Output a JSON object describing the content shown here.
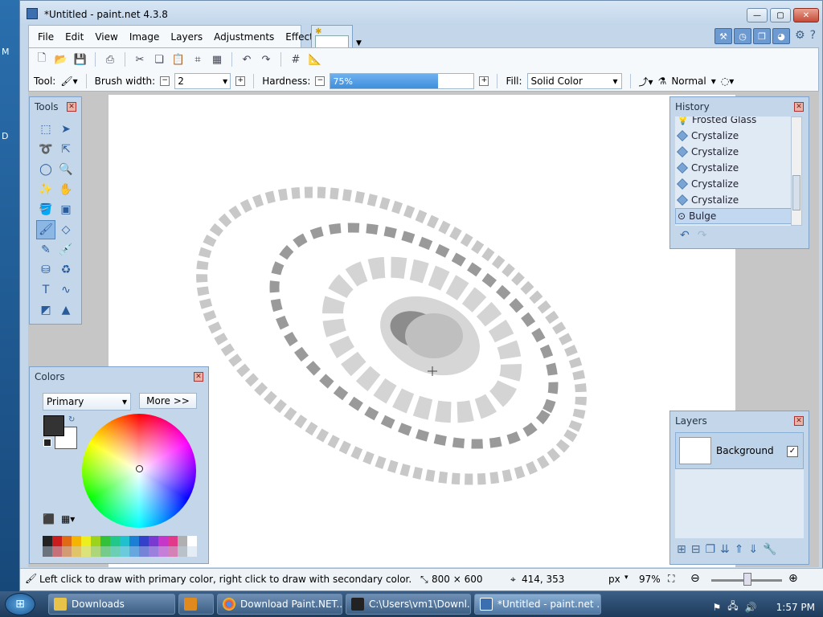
{
  "desktop": {
    "labels": [
      "M",
      "D"
    ]
  },
  "window": {
    "title": "*Untitled - paint.net 4.3.8"
  },
  "menu": [
    "File",
    "Edit",
    "View",
    "Image",
    "Layers",
    "Adjustments",
    "Effects"
  ],
  "toolbar": {
    "tool_label": "Tool:",
    "brush_width_label": "Brush width:",
    "brush_width_value": "2",
    "hardness_label": "Hardness:",
    "hardness_value": "75%",
    "hardness_fraction": 0.75,
    "fill_label": "Fill:",
    "fill_value": "Solid Color",
    "blend_mode": "Normal"
  },
  "tools_panel": {
    "title": "Tools"
  },
  "colors_panel": {
    "title": "Colors",
    "mode": "Primary",
    "more_label": "More >>",
    "primary_color": "#333333",
    "secondary_color": "#ffffff"
  },
  "history_panel": {
    "title": "History",
    "items": [
      "Frosted Glass",
      "Crystalize",
      "Crystalize",
      "Crystalize",
      "Crystalize",
      "Crystalize",
      "Bulge"
    ]
  },
  "layers_panel": {
    "title": "Layers",
    "layer_name": "Background"
  },
  "status": {
    "hint": "Left click to draw with primary color, right click to draw with secondary color.",
    "image_size": "800 × 600",
    "cursor_pos": "414, 353",
    "unit": "px",
    "zoom": "97%"
  },
  "taskbar": {
    "items": [
      "Downloads",
      "Download Paint.NET...",
      "C:\\Users\\vm1\\Downl...",
      "*Untitled - paint.net ..."
    ],
    "time": "1:57 PM"
  },
  "palette_colors": [
    "#222222",
    "#c91c1c",
    "#e06a13",
    "#f5b400",
    "#ecef1e",
    "#9bd31d",
    "#34c13a",
    "#22c88a",
    "#1fc1cf",
    "#1b7fd5",
    "#3440c9",
    "#7a3ad1",
    "#c637c9",
    "#e23a8b",
    "#b0b0b0",
    "#ffffff"
  ]
}
